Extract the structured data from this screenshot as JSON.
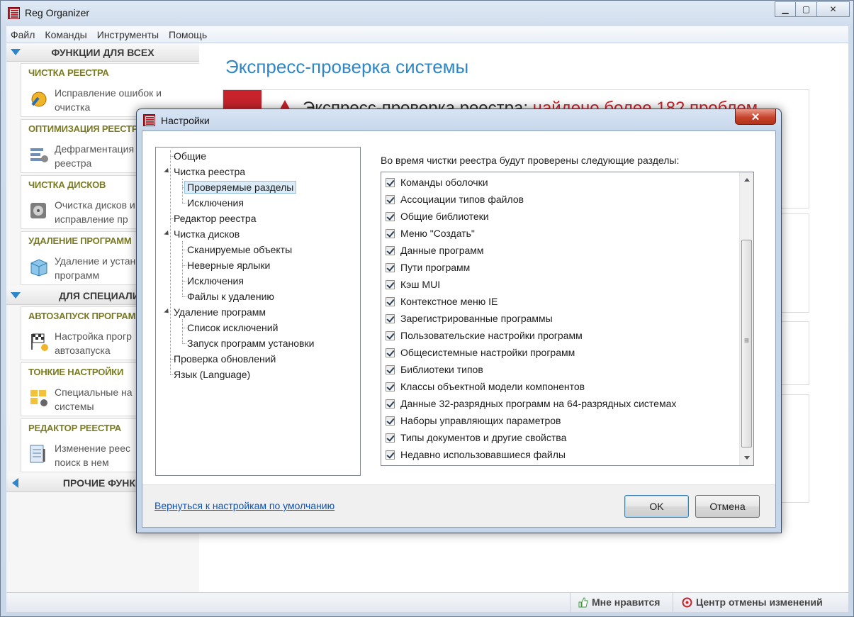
{
  "app": {
    "title": "Reg Organizer",
    "window_buttons": {
      "minimize": "▁",
      "maximize": "▢",
      "close": "✕"
    }
  },
  "menu": [
    "Файл",
    "Команды",
    "Инструменты",
    "Помощь"
  ],
  "sidebar": {
    "section_everyone": "ФУНКЦИИ ДЛЯ ВСЕХ",
    "section_specialists": "ДЛЯ СПЕЦИАЛИС",
    "section_other": "ПРОЧИЕ ФУНКЦ",
    "cards": [
      {
        "title": "ЧИСТКА РЕЕСТРА",
        "line1": "Исправление ошибок и",
        "line2": "очистка",
        "icon": "registry-clean-icon"
      },
      {
        "title": "ОПТИМИЗАЦИЯ РЕЕСТРА",
        "line1": "Дефрагментация",
        "line2": "реестра",
        "icon": "defrag-icon"
      },
      {
        "title": "ЧИСТКА ДИСКОВ",
        "line1": "Очистка дисков и",
        "line2": "исправление пр",
        "icon": "disk-icon"
      },
      {
        "title": "УДАЛЕНИЕ ПРОГРАММ",
        "line1": "Удаление и устан",
        "line2": "программ",
        "icon": "uninstall-icon"
      },
      {
        "title": "АВТОЗАПУСК ПРОГРАММ",
        "line1": "Настройка прогр",
        "line2": "автозапуска",
        "icon": "autorun-icon"
      },
      {
        "title": "ТОНКИЕ НАСТРОЙКИ",
        "line1": "Специальные на",
        "line2": "системы",
        "icon": "tweaks-icon"
      },
      {
        "title": "РЕДАКТОР РЕЕСТРА",
        "line1": "Изменение реес",
        "line2": "поиск в нем",
        "icon": "registry-editor-icon"
      }
    ]
  },
  "main": {
    "title": "Экспресс-проверка системы",
    "alert_prefix": "Экспресс-проверка реестра:",
    "alert_highlight": " найдено более 182 проблем"
  },
  "statusbar": {
    "like": "Мне нравится",
    "undo_center": "Центр отмены изменений"
  },
  "dialog": {
    "title": "Настройки",
    "close": "✕",
    "tree": [
      {
        "label": "Общие",
        "level": 0
      },
      {
        "label": "Чистка реестра",
        "level": 0,
        "expanded": true
      },
      {
        "label": "Проверяемые разделы",
        "level": 1,
        "selected": true
      },
      {
        "label": "Исключения",
        "level": 1
      },
      {
        "label": "Редактор реестра",
        "level": 0
      },
      {
        "label": "Чистка дисков",
        "level": 0,
        "expanded": true
      },
      {
        "label": "Сканируемые объекты",
        "level": 1
      },
      {
        "label": "Неверные ярлыки",
        "level": 1
      },
      {
        "label": "Исключения",
        "level": 1
      },
      {
        "label": "Файлы к удалению",
        "level": 1
      },
      {
        "label": "Удаление программ",
        "level": 0,
        "expanded": true
      },
      {
        "label": "Список исключений",
        "level": 1
      },
      {
        "label": "Запуск программ установки",
        "level": 1
      },
      {
        "label": "Проверка обновлений",
        "level": 0
      },
      {
        "label": "Язык (Language)",
        "level": 0
      }
    ],
    "sections_caption": "Во время чистки реестра будут проверены следующие разделы:",
    "sections": [
      {
        "label": "Команды оболочки",
        "checked": true
      },
      {
        "label": "Ассоциации типов файлов",
        "checked": true
      },
      {
        "label": "Общие библиотеки",
        "checked": true
      },
      {
        "label": "Меню \"Создать\"",
        "checked": true
      },
      {
        "label": "Данные программ",
        "checked": true
      },
      {
        "label": "Пути программ",
        "checked": true
      },
      {
        "label": "Кэш MUI",
        "checked": true
      },
      {
        "label": "Контекстное меню IE",
        "checked": true
      },
      {
        "label": "Зарегистрированные программы",
        "checked": true
      },
      {
        "label": "Пользовательские настройки программ",
        "checked": true
      },
      {
        "label": "Общесистемные настройки программ",
        "checked": true
      },
      {
        "label": "Библиотеки типов",
        "checked": true
      },
      {
        "label": "Классы объектной модели компонентов",
        "checked": true
      },
      {
        "label": "Данные 32-разрядных программ на 64-разрядных системах",
        "checked": true
      },
      {
        "label": "Наборы управляющих параметров",
        "checked": true
      },
      {
        "label": "Типы документов и другие свойства",
        "checked": true
      },
      {
        "label": "Недавно использовавшиеся файлы",
        "checked": true
      }
    ],
    "reset_link": "Вернуться к настройкам по умолчанию",
    "ok": "OK",
    "cancel": "Отмена"
  },
  "colors": {
    "accent": "#2f86c8",
    "alert": "#c8232c",
    "card_title": "#7a7a22"
  }
}
